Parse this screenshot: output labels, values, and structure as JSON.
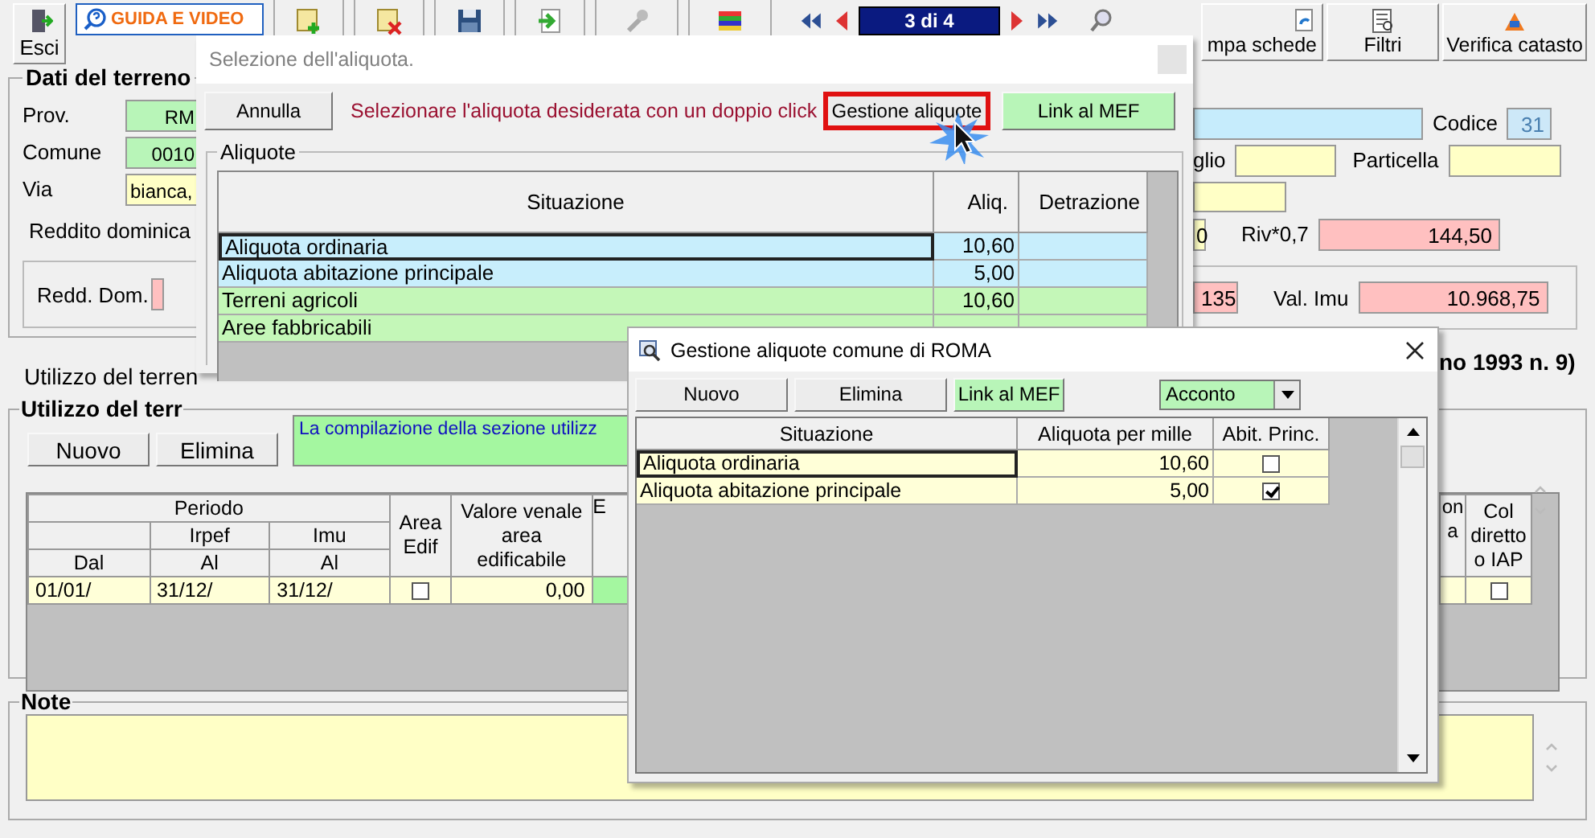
{
  "toolbar": {
    "exit": "Esci",
    "guide": "GUIDA E VIDEO",
    "counter": "3 di 4",
    "buttons": [
      "mpa schede",
      "Filtri",
      "Verifica catasto"
    ]
  },
  "land_left": {
    "title": "Dati del terreno",
    "prov_label": "Prov.",
    "prov": "RM",
    "comune_label": "Comune",
    "comune": "0010",
    "via_label": "Via",
    "via": "bianca,",
    "reddito_label": "Reddito dominica",
    "redd_dom_label": "Redd. Dom."
  },
  "land_right": {
    "codice_label": "Codice",
    "codice": "31",
    "foglio_label": "glio",
    "particella_label": "Particella",
    "reddito": "0",
    "riv_label": "Riv*0,7",
    "riv": "144,50",
    "value": "135",
    "val_imu_label": "Val. Imu",
    "val_imu": "10.968,75",
    "heading_tail": "no 1993 n. 9)"
  },
  "usage": {
    "tab": "Utilizzo del terren",
    "title": "Utilizzo del terr",
    "buttons": [
      "Nuovo",
      "Elimina"
    ],
    "info": "La compilazione della sezione utilizz",
    "headers": {
      "periodo": "Periodo",
      "irpef": "Irpef",
      "imu": "Imu",
      "dal": "Dal",
      "al_irpef": "Al",
      "al_imu": "Al",
      "area_edif": "Area Edif",
      "valore": "Valore venale area edificabile",
      "column_7": "E",
      "column_partial": "on a",
      "col_diretto": "Col diretto o IAP"
    },
    "rows": [
      {
        "dal": "01/01/",
        "irpef_al": "31/12/",
        "imu_al": "31/12/",
        "area_edif": false,
        "valore": "0,00",
        "col_diretto": false
      }
    ]
  },
  "note": {
    "title": "Note"
  },
  "dialog_select": {
    "title": "Selezione dell'aliquota.",
    "cancel": "Annulla",
    "hint": "Selezionare l'aliquota desiderata con un doppio click",
    "manage": "Gestione aliquote",
    "mef": "Link al MEF",
    "group": "Aliquote",
    "columns": [
      "Situazione",
      "Aliq.",
      "Detrazione"
    ],
    "rows": [
      {
        "situazione": "Aliquota ordinaria",
        "aliquota": "10,60",
        "color": "#c8eefc",
        "selected": true
      },
      {
        "situazione": "Aliquota abitazione principale",
        "aliquota": "5,00",
        "color": "#c8eefc",
        "selected": false
      },
      {
        "situazione": "Terreni agricoli",
        "aliquota": "10,60",
        "color": "#c4f7b8",
        "selected": false
      },
      {
        "situazione": "Aree fabbricabili",
        "color": "#c4f7b8",
        "selected": false
      }
    ]
  },
  "dialog_manage": {
    "title": "Gestione aliquote comune di ROMA",
    "new": "Nuovo",
    "delete": "Elimina",
    "mef": "Link al MEF",
    "period": "Acconto",
    "columns": [
      "Situazione",
      "Aliquota per mille",
      "Abit. Princ."
    ],
    "rows": [
      {
        "situazione": "Aliquota ordinaria",
        "aliquota": "10,60",
        "abit_princ": false,
        "selected": true
      },
      {
        "situazione": "Aliquota abitazione principale",
        "aliquota": "5,00",
        "abit_princ": true,
        "selected": false
      }
    ]
  }
}
